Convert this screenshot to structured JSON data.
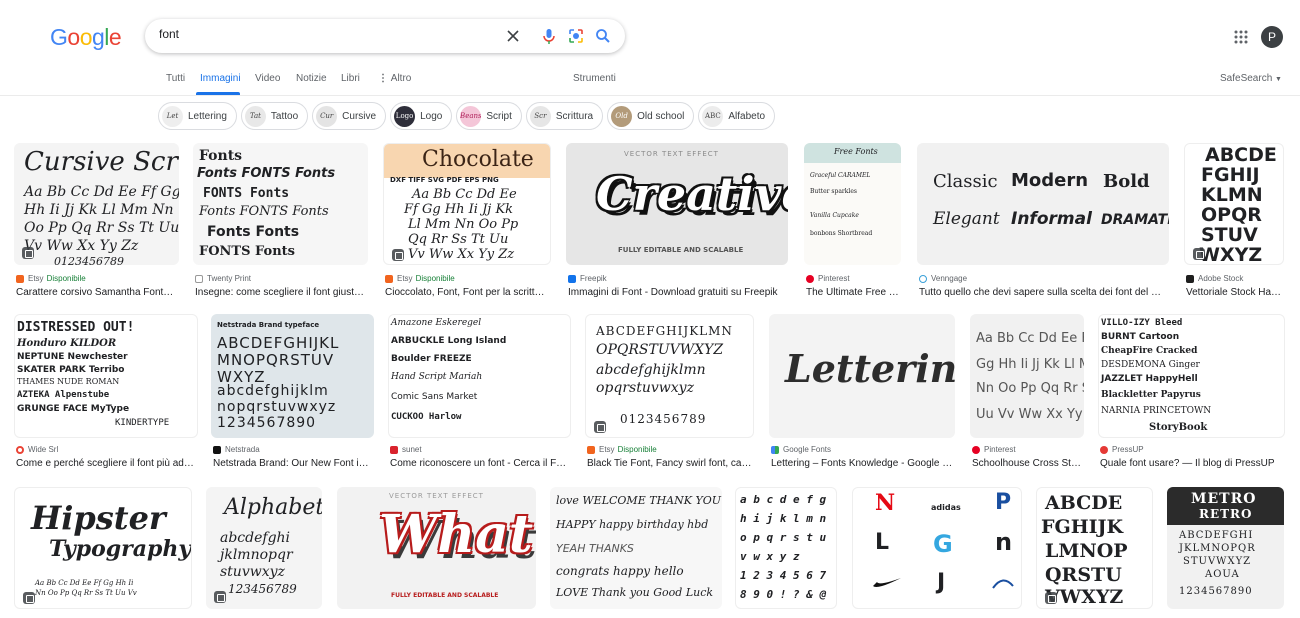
{
  "logo": {
    "letters": [
      "G",
      "o",
      "o",
      "g",
      "l",
      "e"
    ],
    "colors": [
      "#4285f4",
      "#ea4335",
      "#fbbc05",
      "#4285f4",
      "#34a853",
      "#ea4335"
    ]
  },
  "search": {
    "value": "font"
  },
  "account": {
    "initial": "P"
  },
  "tabs": [
    "Tutti",
    "Immagini",
    "Video",
    "Notizie",
    "Libri",
    "Altro"
  ],
  "active_tab": "Immagini",
  "tools_label": "Strumenti",
  "safesearch_label": "SafeSearch",
  "chips": [
    {
      "label": "Lettering",
      "thumb": "Let"
    },
    {
      "label": "Tattoo",
      "thumb": "Tat"
    },
    {
      "label": "Cursive",
      "thumb": "Cur"
    },
    {
      "label": "Logo",
      "thumb": "Logo"
    },
    {
      "label": "Script",
      "thumb": "Beans"
    },
    {
      "label": "Scrittura",
      "thumb": "Scr"
    },
    {
      "label": "Old school",
      "thumb": "Old"
    },
    {
      "label": "Alfabeto",
      "thumb": "ABC"
    }
  ],
  "row1": [
    {
      "source": "Etsy",
      "available": "Disponibile",
      "caption": "Carattere corsivo Samantha Font…",
      "img": {
        "lines": [
          "Cursive Script",
          "Aa Bb Cc Dd Ee Ff Gg",
          "Hh Ii Jj Kk Ll Mm Nn",
          "Oo Pp Qq Rr Ss Tt Uu",
          "Vv Ww Xx Yy Zz",
          "0123456789"
        ]
      }
    },
    {
      "source": "Twenty Print",
      "available": "",
      "caption": "Insegne: come scegliere il font giust…",
      "img": {
        "lines": [
          "Fonts",
          "Fonts FONTS Fonts",
          "FONTS Fonts",
          "Fonts FONTS Fonts",
          "Fonts Fonts",
          "FONTS Fonts"
        ]
      }
    },
    {
      "source": "Etsy",
      "available": "Disponibile",
      "caption": "Cioccolato, Font, Font per la scritt…",
      "img": {
        "lines": [
          "Chocolate",
          "DXF TIFF SVG PDF EPS PNG",
          "Aa Bb Cc Dd Ee",
          "Ff Gg Hh Ii Jj Kk",
          "Ll Mm Nn Oo Pp",
          "Qq Rr Ss Tt Uu",
          "Vv Ww Xx Yy Zz"
        ]
      }
    },
    {
      "source": "Freepik",
      "available": "",
      "caption": "Immagini di Font - Download gratuiti su Freepik",
      "img": {
        "lines": [
          "VECTOR TEXT EFFECT",
          "Creative",
          "FULLY EDITABLE AND SCALABLE"
        ]
      }
    },
    {
      "source": "Pinterest",
      "available": "",
      "caption": "The Ultimate Free …",
      "img": {
        "lines": [
          "Free Fonts",
          "Graceful  CARAMEL",
          "Butter  sparkles",
          "Vanilla  Cupcake",
          "bonbons  Shortbread"
        ]
      }
    },
    {
      "source": "Venngage",
      "available": "",
      "caption": "Tutto quello che devi sapere sulla scelta dei font del …",
      "img": {
        "lines": [
          "Classic",
          "Modern",
          "Bold",
          "Elegant",
          "Informal",
          "DRAMATIC"
        ]
      }
    },
    {
      "source": "Adobe Stock",
      "available": "",
      "caption": "Vettoriale Stock Ha…",
      "img": {
        "lines": [
          "ABCDE",
          "FGHIJ",
          "KLMN",
          "OPQR",
          "STUV",
          "WXYZ"
        ]
      }
    }
  ],
  "row2": [
    {
      "source": "Wide Srl",
      "available": "",
      "caption": "Come e perché scegliere il font più ad…",
      "img": {
        "lines": [
          "DISTRESSED OUT!",
          "Honduro  KILDOR",
          "NEPTUNE  Newchester",
          "SKATER PARK  Terribo",
          "THAMES NUDE ROMAN",
          "AZTEKA  Alpenstube",
          "GRUNGE FACE  MyType",
          "KINDERTYPE"
        ]
      }
    },
    {
      "source": "Netstrada",
      "available": "",
      "caption": "Netstrada Brand: Our New Font i…",
      "img": {
        "lines": [
          "Netstrada Brand typeface",
          "ABCDEFGHIJKL",
          "MNOPQRSTUV",
          "WXYZ",
          "abcdefghijklm",
          "nopqrstuvwxyz",
          "1234567890"
        ]
      }
    },
    {
      "source": "sunet",
      "available": "",
      "caption": "Come riconoscere un font - Cerca il F…",
      "img": {
        "lines": [
          "Amazone  Eskeregel",
          "ARBUCKLE  Long Island",
          "Boulder  FREEZE",
          "Hand Script  Mariah",
          "Comic Sans  Market",
          "CUCKOO  Harlow"
        ]
      }
    },
    {
      "source": "Etsy",
      "available": "Disponibile",
      "caption": "Black Tie Font, Fancy swirl font, ca…",
      "img": {
        "lines": [
          "ABCDEFGHIJKLMN",
          "OPQRSTUVWXYZ",
          "abcdefghijklmn",
          "opqrstuvwxyz",
          "0123456789"
        ]
      }
    },
    {
      "source": "Google Fonts",
      "available": "",
      "caption": "Lettering – Fonts Knowledge - Google …",
      "img": {
        "lines": [
          "Lettering"
        ]
      }
    },
    {
      "source": "Pinterest",
      "available": "",
      "caption": "Schoolhouse Cross St…",
      "img": {
        "lines": [
          "Aa Bb Cc Dd Ee Ff",
          "Gg Hh Ii Jj Kk Ll Mm",
          "Nn Oo Pp Qq Rr Ss Tt",
          "Uu Vv Ww Xx Yy Zz"
        ]
      }
    },
    {
      "source": "PressUP",
      "available": "",
      "caption": "Quale font usare? — Il blog di PressUP",
      "img": {
        "lines": [
          "VILLO-IZY  Bleed",
          "BURNT  Cartoon",
          "CheapFire  Cracked",
          "DESDEMONA  Ginger",
          "JAZZLET  HappyHell",
          "Blackletter  Papyrus",
          "NARNIA  PRINCETOWN",
          "StoryBook"
        ]
      }
    }
  ],
  "row3": [
    {
      "img": {
        "lines": [
          "Hipster",
          "Typography",
          "Aa Bb Cc Dd Ee Ff Gg Hh Ii",
          "Nn Oo Pp Qq Rr Ss Tt Uu Vv"
        ]
      }
    },
    {
      "img": {
        "lines": [
          "Alphabet",
          "abcdefghi",
          "jklmnopqr",
          "stuvwxyz",
          "123456789"
        ]
      }
    },
    {
      "img": {
        "lines": [
          "VECTOR TEXT EFFECT",
          "What",
          "FULLY EDITABLE AND SCALABLE"
        ]
      }
    },
    {
      "img": {
        "lines": [
          "love  WELCOME  THANK YOU  HELLO",
          "HAPPY  happy birthday  hbd",
          "YEAH  THANKS",
          "congrats  happy  hello",
          "LOVE  Thank you  Good Luck"
        ]
      }
    },
    {
      "img": {
        "lines": [
          "a b c d e f g",
          "h i j k l m n",
          "o p q r s t u",
          "v w x y z",
          "1 2 3 4 5 6 7",
          "8 9 0 ! ? & @"
        ]
      }
    },
    {
      "img": {
        "lines": [
          "N",
          "adidas",
          "P",
          "L",
          "G",
          "n",
          "J"
        ]
      }
    },
    {
      "img": {
        "lines": [
          "ABCDE",
          "FGHIJK",
          "LMNOP",
          "QRSTU",
          "VWXYZ"
        ]
      }
    },
    {
      "img": {
        "lines": [
          "METRO",
          "RETRO",
          "ABCDEFGHI",
          "JKLMNOPQR",
          "STUVWXYZ",
          "AOUA",
          "1234567890"
        ]
      }
    }
  ]
}
